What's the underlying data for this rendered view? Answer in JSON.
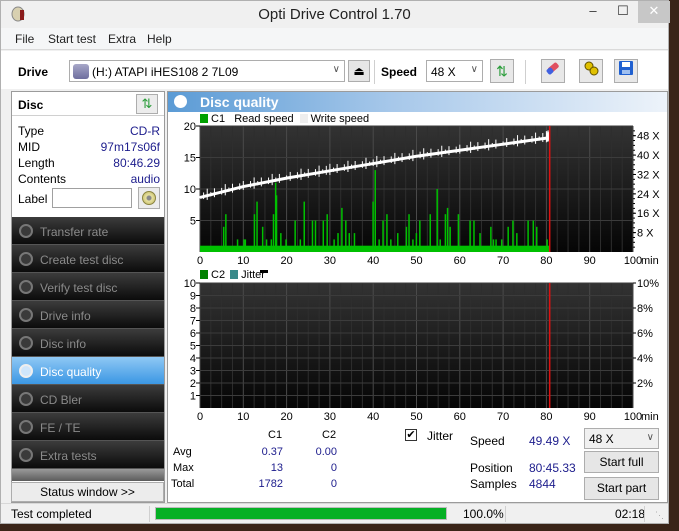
{
  "window": {
    "title": "Opti Drive Control 1.70",
    "minimize": "–",
    "maximize": "☐",
    "close": "✕"
  },
  "menu": [
    "File",
    "Start test",
    "Extra",
    "Help"
  ],
  "toolbar": {
    "drive_label": "Drive",
    "drive_value": "(H:)  ATAPI iHES108   2 7L09",
    "speed_label": "Speed",
    "speed_value": "48 X",
    "icons": [
      "eject-icon",
      "refresh-icon",
      "erase-icon",
      "settings-icon",
      "save-icon"
    ]
  },
  "disc": {
    "header": "Disc",
    "fields": [
      {
        "key": "Type",
        "value": "CD-R"
      },
      {
        "key": "MID",
        "value": "97m17s06f"
      },
      {
        "key": "Length",
        "value": "80:46.29"
      },
      {
        "key": "Contents",
        "value": "audio"
      }
    ],
    "label_key": "Label",
    "label_value": ""
  },
  "nav": [
    {
      "label": "Transfer rate",
      "active": false
    },
    {
      "label": "Create test disc",
      "active": false
    },
    {
      "label": "Verify test disc",
      "active": false
    },
    {
      "label": "Drive info",
      "active": false
    },
    {
      "label": "Disc info",
      "active": false
    },
    {
      "label": "Disc quality",
      "active": true
    },
    {
      "label": "CD Bler",
      "active": false
    },
    {
      "label": "FE / TE",
      "active": false
    },
    {
      "label": "Extra tests",
      "active": false
    }
  ],
  "status_window_button": "Status window >>",
  "panel_title": "Disc quality",
  "colors": {
    "c1": "#00c000",
    "c2": "#008000",
    "jitter": "#3a8a8a",
    "read_speed": "#ffffff",
    "marker": "#e01010",
    "progress": "#06b025"
  },
  "chart_data": [
    {
      "type": "bar",
      "title": "C1 / Read speed",
      "legend": [
        "C1",
        "Read speed",
        "Write speed"
      ],
      "x_unit": "min",
      "xlim": [
        0,
        100
      ],
      "x_ticks": [
        0,
        10,
        20,
        30,
        40,
        50,
        60,
        70,
        80,
        90,
        100
      ],
      "ylim": [
        0,
        20
      ],
      "y_ticks": [
        5,
        10,
        15,
        20
      ],
      "y2lim": [
        0,
        52
      ],
      "y2_ticks": [
        "8 X",
        "16 X",
        "24 X",
        "32 X",
        "40 X",
        "48 X"
      ],
      "y2_tick_values": [
        8,
        16,
        24,
        32,
        40,
        48
      ],
      "end_marker_min": 80.76,
      "c1_baseline": 1,
      "c1_spikes": [
        {
          "x": 5.3,
          "y": 4
        },
        {
          "x": 5.8,
          "y": 6
        },
        {
          "x": 8.5,
          "y": 2
        },
        {
          "x": 10.0,
          "y": 2
        },
        {
          "x": 10.3,
          "y": 2
        },
        {
          "x": 12.4,
          "y": 6
        },
        {
          "x": 13.0,
          "y": 8
        },
        {
          "x": 14.3,
          "y": 4
        },
        {
          "x": 15.2,
          "y": 2
        },
        {
          "x": 16.3,
          "y": 2
        },
        {
          "x": 16.8,
          "y": 6
        },
        {
          "x": 17.3,
          "y": 11
        },
        {
          "x": 17.5,
          "y": 9
        },
        {
          "x": 18.5,
          "y": 3
        },
        {
          "x": 19.7,
          "y": 2
        },
        {
          "x": 21.8,
          "y": 5
        },
        {
          "x": 23.0,
          "y": 2
        },
        {
          "x": 23.9,
          "y": 8
        },
        {
          "x": 25.8,
          "y": 5
        },
        {
          "x": 26.5,
          "y": 5
        },
        {
          "x": 28.3,
          "y": 5
        },
        {
          "x": 29.2,
          "y": 6
        },
        {
          "x": 30.8,
          "y": 2
        },
        {
          "x": 31.7,
          "y": 3
        },
        {
          "x": 32.6,
          "y": 7
        },
        {
          "x": 33.5,
          "y": 5
        },
        {
          "x": 34.3,
          "y": 3
        },
        {
          "x": 35.5,
          "y": 3
        },
        {
          "x": 39.8,
          "y": 8
        },
        {
          "x": 40.3,
          "y": 13
        },
        {
          "x": 41.2,
          "y": 2
        },
        {
          "x": 42.1,
          "y": 5
        },
        {
          "x": 43.0,
          "y": 6
        },
        {
          "x": 43.9,
          "y": 2
        },
        {
          "x": 45.5,
          "y": 3
        },
        {
          "x": 47.5,
          "y": 4
        },
        {
          "x": 48.1,
          "y": 6
        },
        {
          "x": 49.0,
          "y": 2
        },
        {
          "x": 49.8,
          "y": 3
        },
        {
          "x": 50.6,
          "y": 5
        },
        {
          "x": 53.0,
          "y": 6
        },
        {
          "x": 54.6,
          "y": 10
        },
        {
          "x": 55.3,
          "y": 2
        },
        {
          "x": 56.5,
          "y": 6
        },
        {
          "x": 57.0,
          "y": 7
        },
        {
          "x": 57.6,
          "y": 4
        },
        {
          "x": 59.5,
          "y": 6
        },
        {
          "x": 62.2,
          "y": 5
        },
        {
          "x": 63.1,
          "y": 5
        },
        {
          "x": 64.5,
          "y": 3
        },
        {
          "x": 67.0,
          "y": 4
        },
        {
          "x": 67.6,
          "y": 2
        },
        {
          "x": 68.2,
          "y": 2
        },
        {
          "x": 69.5,
          "y": 2
        },
        {
          "x": 71.0,
          "y": 4
        },
        {
          "x": 72.1,
          "y": 5
        },
        {
          "x": 73.0,
          "y": 3
        },
        {
          "x": 75.6,
          "y": 5
        },
        {
          "x": 76.8,
          "y": 5
        },
        {
          "x": 77.6,
          "y": 4
        },
        {
          "x": 80.0,
          "y": 2
        }
      ],
      "read_speed_x": [
        0,
        10,
        20,
        30,
        40,
        50,
        60,
        70,
        80,
        80.76
      ],
      "read_speed_y": [
        22.5,
        27,
        30.5,
        33.5,
        36.5,
        39.5,
        42,
        44.5,
        47,
        47.5
      ]
    },
    {
      "type": "bar",
      "title": "C2 / Jitter",
      "legend": [
        "C2",
        "Jitter"
      ],
      "x_unit": "min",
      "xlim": [
        0,
        100
      ],
      "x_ticks": [
        0,
        10,
        20,
        30,
        40,
        50,
        60,
        70,
        80,
        90,
        100
      ],
      "ylim": [
        0,
        10
      ],
      "y_ticks": [
        1,
        2,
        3,
        4,
        5,
        6,
        7,
        8,
        9,
        10
      ],
      "y2_ticks": [
        "2%",
        "4%",
        "6%",
        "8%",
        "10%"
      ],
      "y2_tick_values": [
        2,
        4,
        6,
        8,
        10
      ],
      "end_marker_min": 80.76,
      "c2_values": []
    }
  ],
  "stats": {
    "columns": [
      "C1",
      "C2"
    ],
    "rows": [
      {
        "label": "Avg",
        "c1": "0.37",
        "c2": "0.00"
      },
      {
        "label": "Max",
        "c1": "13",
        "c2": "0"
      },
      {
        "label": "Total",
        "c1": "1782",
        "c2": "0"
      }
    ],
    "jitter_label": "Jitter",
    "jitter_checked": true,
    "speed_label": "Speed",
    "speed_value": "49.49 X",
    "position_label": "Position",
    "position_value": "80:45.33",
    "samples_label": "Samples",
    "samples_value": "4844",
    "speed_select": "48 X",
    "start_full": "Start full",
    "start_part": "Start part"
  },
  "statusbar": {
    "message": "Test completed",
    "progress_percent": 100,
    "progress_text": "100.0%",
    "elapsed": "02:18"
  }
}
